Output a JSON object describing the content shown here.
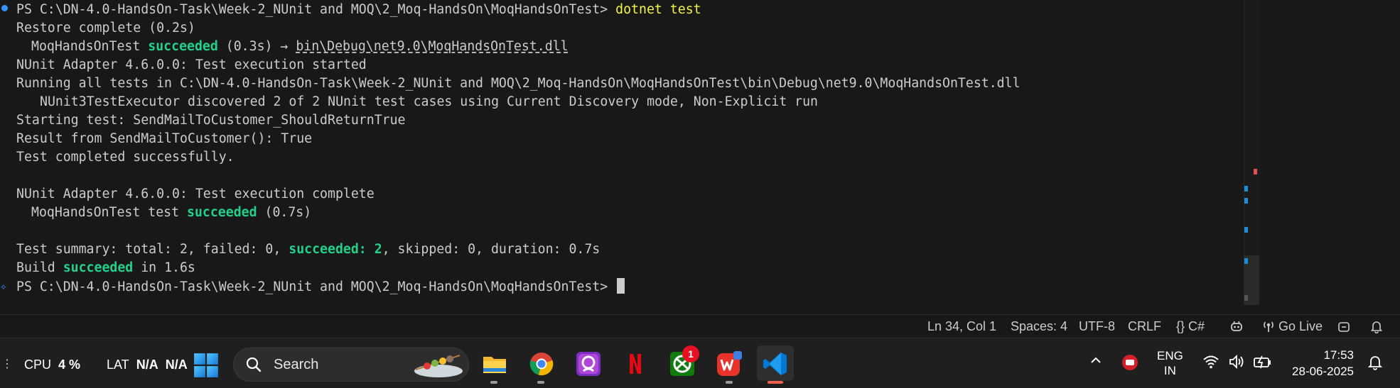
{
  "terminal": {
    "prompt_path": "PS C:\\DN-4.0-HandsOn-Task\\Week-2_NUnit and MOQ\\2_Moq-HandsOn\\MoqHandsOnTest> ",
    "command": "dotnet test",
    "restore": "Restore complete (0.2s)",
    "build_project": "MoqHandsOnTest",
    "build_status": "succeeded",
    "build_time_arrow": " (0.3s) → ",
    "build_output_path": "bin\\Debug\\net9.0\\MoqHandsOnTest.dll",
    "adapter_start": "NUnit Adapter 4.6.0.0: Test execution started",
    "running_all": "Running all tests in C:\\DN-4.0-HandsOn-Task\\Week-2_NUnit and MOQ\\2_Moq-HandsOn\\MoqHandsOnTest\\bin\\Debug\\net9.0\\MoqHandsOnTest.dll",
    "discovered": "NUnit3TestExecutor discovered 2 of 2 NUnit test cases using Current Discovery mode, Non-Explicit run",
    "starting_test": "Starting test: SendMailToCustomer_ShouldReturnTrue",
    "result_line": "Result from SendMailToCustomer(): True",
    "test_completed": "Test completed successfully.",
    "adapter_complete": "NUnit Adapter 4.6.0.0: Test execution complete",
    "test_project_prefix": "MoqHandsOnTest test ",
    "test_status": "succeeded",
    "test_time": " (0.7s)",
    "summary_prefix": "Test summary: total: 2, failed: 0, ",
    "summary_succeeded": "succeeded: 2",
    "summary_suffix": ", skipped: 0, duration: 0.7s",
    "build_prefix": "Build ",
    "build_final_status": "succeeded",
    "build_suffix": " in 1.6s",
    "final_prompt": "PS C:\\DN-4.0-HandsOn-Task\\Week-2_NUnit and MOQ\\2_Moq-HandsOn\\MoqHandsOnTest> "
  },
  "statusbar": {
    "cursor_position": "Ln 34, Col 1",
    "indentation": "Spaces: 4",
    "encoding": "UTF-8",
    "line_ending": "CRLF",
    "language_braces": "{}",
    "language": "C#",
    "go_live": "Go Live"
  },
  "taskbar": {
    "cpu_label": "CPU",
    "cpu_value": "4 %",
    "lat_label": "LAT",
    "lat_value1": "N/A",
    "lat_value2": "N/A",
    "search_placeholder": "Search",
    "xbox_badge": "1",
    "language_top": "ENG",
    "language_bottom": "IN",
    "time": "17:53",
    "date": "28-06-2025"
  },
  "colors": {
    "terminal_bg": "#181818",
    "success_green": "#23d18b",
    "command_yellow": "#f5f543",
    "vscode_blue": "#0078d4",
    "accent_red": "#e81123"
  },
  "icons": {
    "start": "windows-start-icon",
    "search": "search-icon",
    "file_explorer": "file-explorer-icon",
    "chrome": "chrome-icon",
    "netflix": "netflix-icon",
    "xbox": "xbox-icon",
    "wps": "wps-office-icon",
    "vscode": "vscode-icon"
  }
}
